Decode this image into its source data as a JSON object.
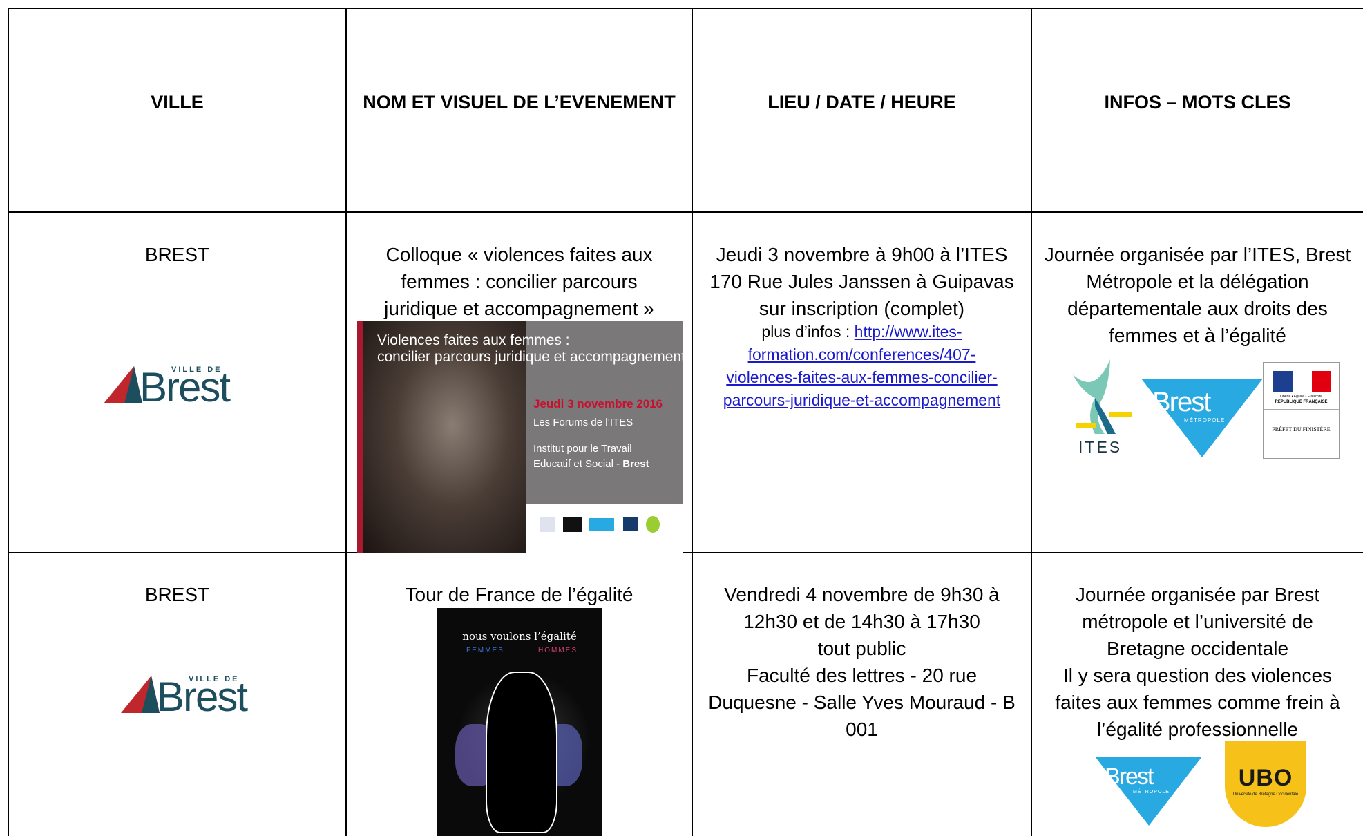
{
  "headers": {
    "ville": "VILLE",
    "evenement": "NOM ET VISUEL DE L’EVENEMENT",
    "lieu": "LIEU / DATE / HEURE",
    "infos": "INFOS – MOTS CLES"
  },
  "rows": [
    {
      "ville": "BREST",
      "event_lines": [
        "Colloque « violences faites aux",
        "femmes : concilier parcours",
        "juridique et accompagnement »"
      ],
      "lieu_lines": [
        "Jeudi 3 novembre à 9h00 à l’ITES",
        "170 Rue Jules Janssen à Guipavas",
        "sur inscription (complet)"
      ],
      "more_prefix": "plus d’infos : ",
      "link_lines": [
        "http://www.ites-",
        "formation.com/conferences/407-",
        "violences-faites-aux-femmes-concilier-",
        "parcours-juridique-et-accompagnement"
      ],
      "infos_lines": [
        "Journée organisée par l’ITES, Brest",
        "Métropole et la délégation",
        "départementale aux droits des",
        "femmes et à l’égalité"
      ],
      "poster": {
        "title1": "Violences faites aux femmes :",
        "title2": "concilier parcours juridique et accompagnement",
        "date": "Jeudi 3 novembre 2016",
        "forum": "Les Forums de l’ITES",
        "inst1": "Institut pour le Travail",
        "inst2": "Educatif et Social - ",
        "inst2b": "Brest"
      },
      "logos": {
        "ites": "ITES",
        "brest_metro": "Brest",
        "brest_metro_sub": "MÉTROPOLE",
        "rf_motto": "Liberté • Égalité • Fraternité",
        "rf_name": "RÉPUBLIQUE FRANÇAISE",
        "prefet": "PRÉFET DU FINISTÈRE"
      }
    },
    {
      "ville": "BREST",
      "event_lines": [
        "Tour de France de l’égalité"
      ],
      "lieu_lines": [
        "Vendredi 4 novembre de 9h30 à",
        "12h30 et de 14h30 à 17h30",
        "tout public",
        "Faculté des lettres - 20 rue",
        "Duquesne - Salle Yves Mouraud - B",
        "001"
      ],
      "infos_lines": [
        "Journée organisée par Brest",
        "métropole et l’université de",
        "Bretagne occidentale",
        "Il y sera question des violences",
        "faites aux femmes comme frein à",
        "l’égalité professionnelle"
      ],
      "poster": {
        "title": "nous voulons l’égalité",
        "femmes": "FEMMES",
        "hommes": "HOMMES"
      },
      "logos": {
        "brest_metro": "Brest",
        "brest_metro_sub": "MÉTROPOLE",
        "ubo": "UBO",
        "ubo_sub": "Université de Bretagne Occidentale"
      }
    }
  ],
  "brest_logo": {
    "ville_de": "VILLE DE",
    "brest": "Brest"
  },
  "colors": {
    "border": "#000000",
    "link": "#1a1acc",
    "brest_teal": "#1d4e5e",
    "brest_red": "#c0272d",
    "metro_blue": "#29a9e1",
    "ubo_yellow": "#f6c21a"
  }
}
